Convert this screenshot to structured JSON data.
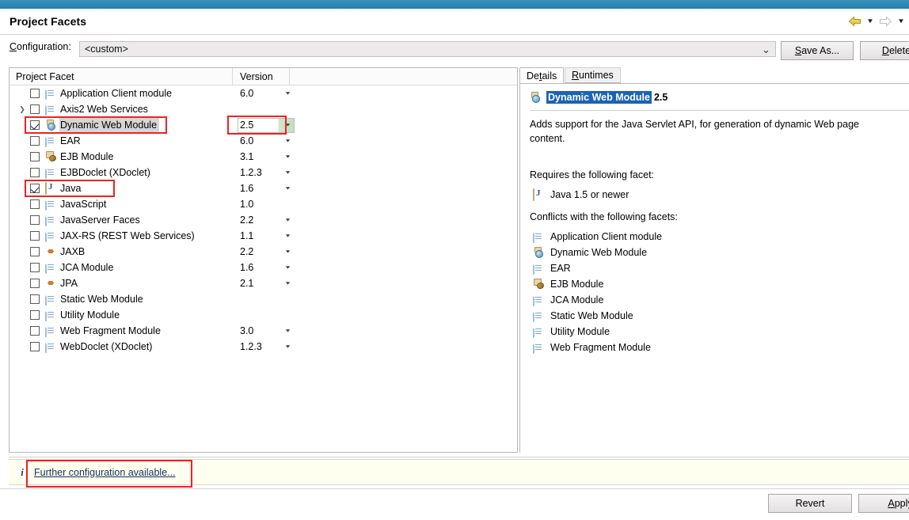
{
  "window": {
    "title": "Project Facets"
  },
  "header": {
    "nav_back_icon": "back-arrow-icon",
    "nav_back_dropdown_icon": "chevron-down-icon",
    "nav_forward_icon": "forward-arrow-icon",
    "nav_forward_dropdown_icon": "chevron-down-icon"
  },
  "configuration": {
    "label": "Configuration:",
    "label_mnemonic": "C",
    "label_rest": "onfiguration:",
    "value": "<custom>",
    "dropdown_icon": "chevron-down-icon",
    "save_as_button": "Save As...",
    "save_as_mnemonic": "S",
    "save_as_rest": "ave As...",
    "delete_button": "Delete",
    "delete_mnemonic": "D",
    "delete_rest": "elete"
  },
  "facet_table": {
    "columns": [
      "Project Facet",
      "Version"
    ],
    "rows": [
      {
        "name": "Application Client module",
        "version": "6.0",
        "checked": false,
        "icon": "doc-icon",
        "has_dropdown": true,
        "expandable": false,
        "selected": false
      },
      {
        "name": "Axis2 Web Services",
        "version": "",
        "checked": false,
        "icon": "doc-icon",
        "has_dropdown": false,
        "expandable": true,
        "selected": false
      },
      {
        "name": "Dynamic Web Module",
        "version": "2.5",
        "checked": true,
        "icon": "web-module-icon",
        "has_dropdown": true,
        "expandable": false,
        "selected": true
      },
      {
        "name": "EAR",
        "version": "6.0",
        "checked": false,
        "icon": "doc-icon",
        "has_dropdown": true,
        "expandable": false,
        "selected": false
      },
      {
        "name": "EJB Module",
        "version": "3.1",
        "checked": false,
        "icon": "ejb-icon",
        "has_dropdown": true,
        "expandable": false,
        "selected": false
      },
      {
        "name": "EJBDoclet (XDoclet)",
        "version": "1.2.3",
        "checked": false,
        "icon": "doc-icon",
        "has_dropdown": true,
        "expandable": false,
        "selected": false
      },
      {
        "name": "Java",
        "version": "1.6",
        "checked": true,
        "icon": "java-icon",
        "has_dropdown": true,
        "expandable": false,
        "selected": false
      },
      {
        "name": "JavaScript",
        "version": "1.0",
        "checked": false,
        "icon": "doc-icon",
        "has_dropdown": false,
        "expandable": false,
        "selected": false
      },
      {
        "name": "JavaServer Faces",
        "version": "2.2",
        "checked": false,
        "icon": "doc-icon",
        "has_dropdown": true,
        "expandable": false,
        "selected": false
      },
      {
        "name": "JAX-RS (REST Web Services)",
        "version": "1.1",
        "checked": false,
        "icon": "doc-icon",
        "has_dropdown": true,
        "expandable": false,
        "selected": false
      },
      {
        "name": "JAXB",
        "version": "2.2",
        "checked": false,
        "icon": "arrows-icon",
        "has_dropdown": true,
        "expandable": false,
        "selected": false
      },
      {
        "name": "JCA Module",
        "version": "1.6",
        "checked": false,
        "icon": "doc-icon",
        "has_dropdown": true,
        "expandable": false,
        "selected": false
      },
      {
        "name": "JPA",
        "version": "2.1",
        "checked": false,
        "icon": "arrows-icon",
        "has_dropdown": true,
        "expandable": false,
        "selected": false
      },
      {
        "name": "Static Web Module",
        "version": "",
        "checked": false,
        "icon": "doc-icon",
        "has_dropdown": false,
        "expandable": false,
        "selected": false
      },
      {
        "name": "Utility Module",
        "version": "",
        "checked": false,
        "icon": "doc-icon",
        "has_dropdown": false,
        "expandable": false,
        "selected": false
      },
      {
        "name": "Web Fragment Module",
        "version": "3.0",
        "checked": false,
        "icon": "doc-icon",
        "has_dropdown": true,
        "expandable": false,
        "selected": false
      },
      {
        "name": "WebDoclet (XDoclet)",
        "version": "1.2.3",
        "checked": false,
        "icon": "doc-icon",
        "has_dropdown": true,
        "expandable": false,
        "selected": false
      }
    ]
  },
  "details": {
    "tabs": [
      {
        "label": "Details",
        "mnemonic": "t",
        "active": true
      },
      {
        "label": "Runtimes",
        "mnemonic": "R",
        "active": false
      }
    ],
    "tab_details_pre": "De",
    "tab_details_mn": "t",
    "tab_details_post": "ails",
    "tab_runtimes_mn": "R",
    "tab_runtimes_post": "untimes",
    "facet_name": "Dynamic Web Module",
    "facet_version": "2.5",
    "facet_icon": "web-module-icon",
    "description": "Adds support for the Java Servlet API, for generation of dynamic Web page content.",
    "requires_heading": "Requires the following facet:",
    "requires": [
      {
        "label": "Java 1.5 or newer",
        "icon": "java-icon"
      }
    ],
    "conflicts_heading": "Conflicts with the following facets:",
    "conflicts": [
      {
        "label": "Application Client module",
        "icon": "doc-icon"
      },
      {
        "label": "Dynamic Web Module",
        "icon": "web-module-icon"
      },
      {
        "label": "EAR",
        "icon": "doc-icon"
      },
      {
        "label": "EJB Module",
        "icon": "ejb-icon"
      },
      {
        "label": "JCA Module",
        "icon": "doc-icon"
      },
      {
        "label": "Static Web Module",
        "icon": "doc-icon"
      },
      {
        "label": "Utility Module",
        "icon": "doc-icon"
      },
      {
        "label": "Web Fragment Module",
        "icon": "doc-icon"
      }
    ]
  },
  "info_bar": {
    "icon": "info-icon",
    "icon_glyph": "i",
    "link_text": "Further configuration available..."
  },
  "footer": {
    "revert_button": "Revert",
    "apply_button": "Apply",
    "apply_mnemonic": "A",
    "apply_rest": "pply"
  },
  "colors": {
    "titlebar": "#2b87b3",
    "selection_blue": "#1b63b5",
    "row_selected": "#d6d6d6",
    "info_bg": "#fffff0",
    "annotation_red": "#ee2222",
    "version_highlight_green": "#bfe0bf"
  }
}
